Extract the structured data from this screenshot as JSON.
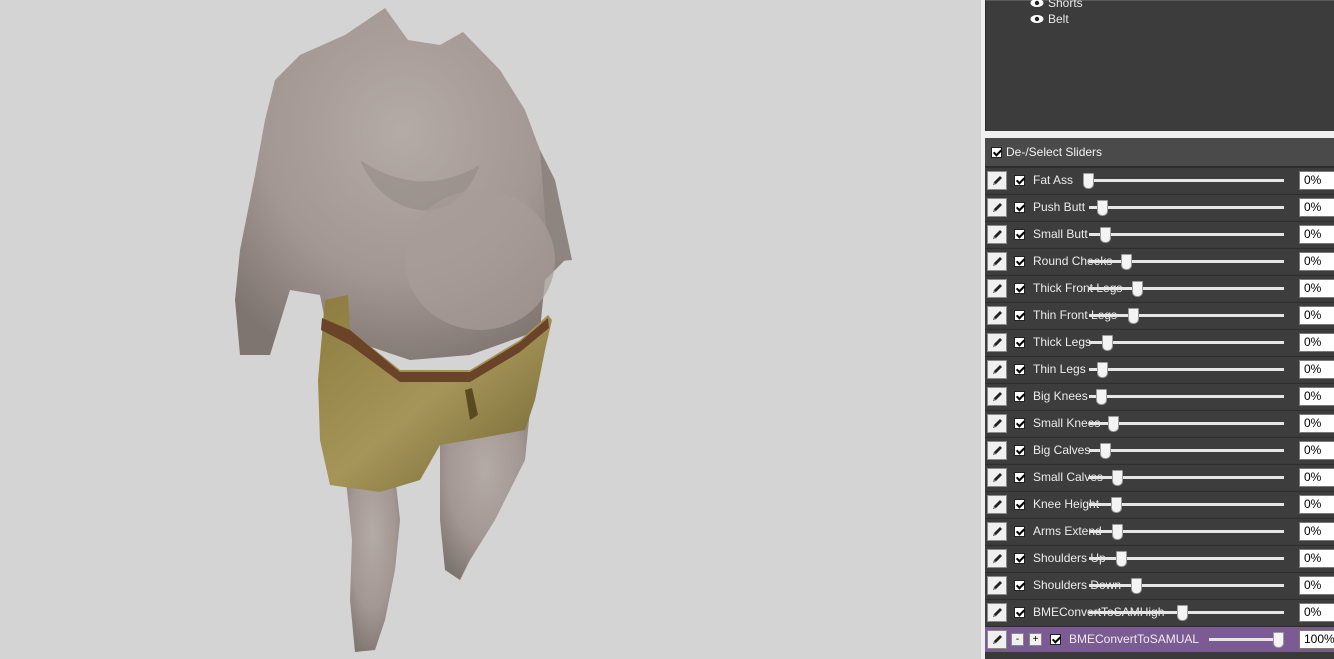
{
  "outliner": {
    "items": [
      {
        "label": "Shorts",
        "icon": "eye-icon"
      },
      {
        "label": "Belt",
        "icon": "eye-icon"
      }
    ]
  },
  "slider_panel": {
    "deselect_label": "De-/Select Sliders",
    "sliders": [
      {
        "label": "Fat Ass",
        "value": "0%",
        "level": 0
      },
      {
        "label": "Push Butt",
        "value": "0%",
        "level": 0
      },
      {
        "label": "Small Butt",
        "value": "0%",
        "level": 0
      },
      {
        "label": "Round Cheeks",
        "value": "0%",
        "level": 0
      },
      {
        "label": "Thick Front Legs",
        "value": "0%",
        "level": 0
      },
      {
        "label": "Thin Front Legs",
        "value": "0%",
        "level": 0
      },
      {
        "label": "Thick Legs",
        "value": "0%",
        "level": 0
      },
      {
        "label": "Thin Legs",
        "value": "0%",
        "level": 0
      },
      {
        "label": "Big Knees",
        "value": "0%",
        "level": 0
      },
      {
        "label": "Small Knees",
        "value": "0%",
        "level": 0
      },
      {
        "label": "Big Calves",
        "value": "0%",
        "level": 0
      },
      {
        "label": "Small Calves",
        "value": "0%",
        "level": 0
      },
      {
        "label": "Knee Height",
        "value": "0%",
        "level": 0
      },
      {
        "label": "Arms Extend",
        "value": "0%",
        "level": 0
      },
      {
        "label": "Shoulders Up",
        "value": "0%",
        "level": 0
      },
      {
        "label": "Shoulders Down",
        "value": "0%",
        "level": 0
      },
      {
        "label": "BMEConvertToSAMHigh",
        "value": "0%",
        "level": 0
      },
      {
        "label": "BMEConvertToSAMUAL",
        "value": "100%",
        "level": 100,
        "selected": true,
        "minus": "-",
        "plus": "+"
      }
    ]
  },
  "colors": {
    "viewport_bg": "#d4d4d4",
    "panel_bg": "#3d3d3d",
    "selected_row": "#7c5a94"
  }
}
